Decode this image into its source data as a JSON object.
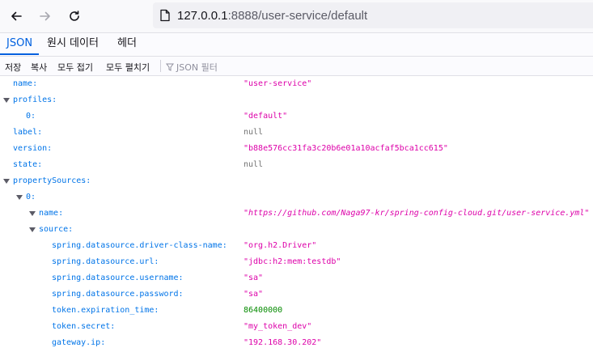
{
  "browser": {
    "url_host": "127.0.0.1",
    "url_rest": ":8888/user-service/default",
    "back_icon": "arrow-left-icon",
    "forward_icon": "arrow-right-icon",
    "reload_icon": "reload-icon",
    "page_icon": "page-icon"
  },
  "viewer": {
    "tabs": [
      "JSON",
      "원시 데이터",
      "헤더"
    ],
    "actions": [
      "저장",
      "복사",
      "모두 접기",
      "모두 펼치기"
    ],
    "filter_placeholder": "JSON 필터"
  },
  "json": {
    "name_key": "name:",
    "name_val": "\"user-service\"",
    "profiles_key": "profiles:",
    "profiles_0_key": "0:",
    "profiles_0_val": "\"default\"",
    "label_key": "label:",
    "label_val": "null",
    "version_key": "version:",
    "version_val": "\"b88e576cc31fa3c20b6e01a10acfaf5bca1cc615\"",
    "state_key": "state:",
    "state_val": "null",
    "propertySources_key": "propertySources:",
    "ps_0_key": "0:",
    "ps_name_key": "name:",
    "ps_name_val": "\"https://github.com/Naga97-kr/spring-config-cloud.git/user-service.yml\"",
    "source_key": "source:",
    "source": [
      {
        "key": "spring.datasource.driver-class-name:",
        "val": "\"org.h2.Driver\""
      },
      {
        "key": "spring.datasource.url:",
        "val": "\"jdbc:h2:mem:testdb\""
      },
      {
        "key": "spring.datasource.username:",
        "val": "\"sa\""
      },
      {
        "key": "spring.datasource.password:",
        "val": "\"sa\""
      },
      {
        "key": "token.expiration_time:",
        "val": "86400000"
      },
      {
        "key": "token.secret:",
        "val": "\"my_token_dev\""
      },
      {
        "key": "gateway.ip:",
        "val": "\"192.168.30.202\""
      }
    ]
  }
}
